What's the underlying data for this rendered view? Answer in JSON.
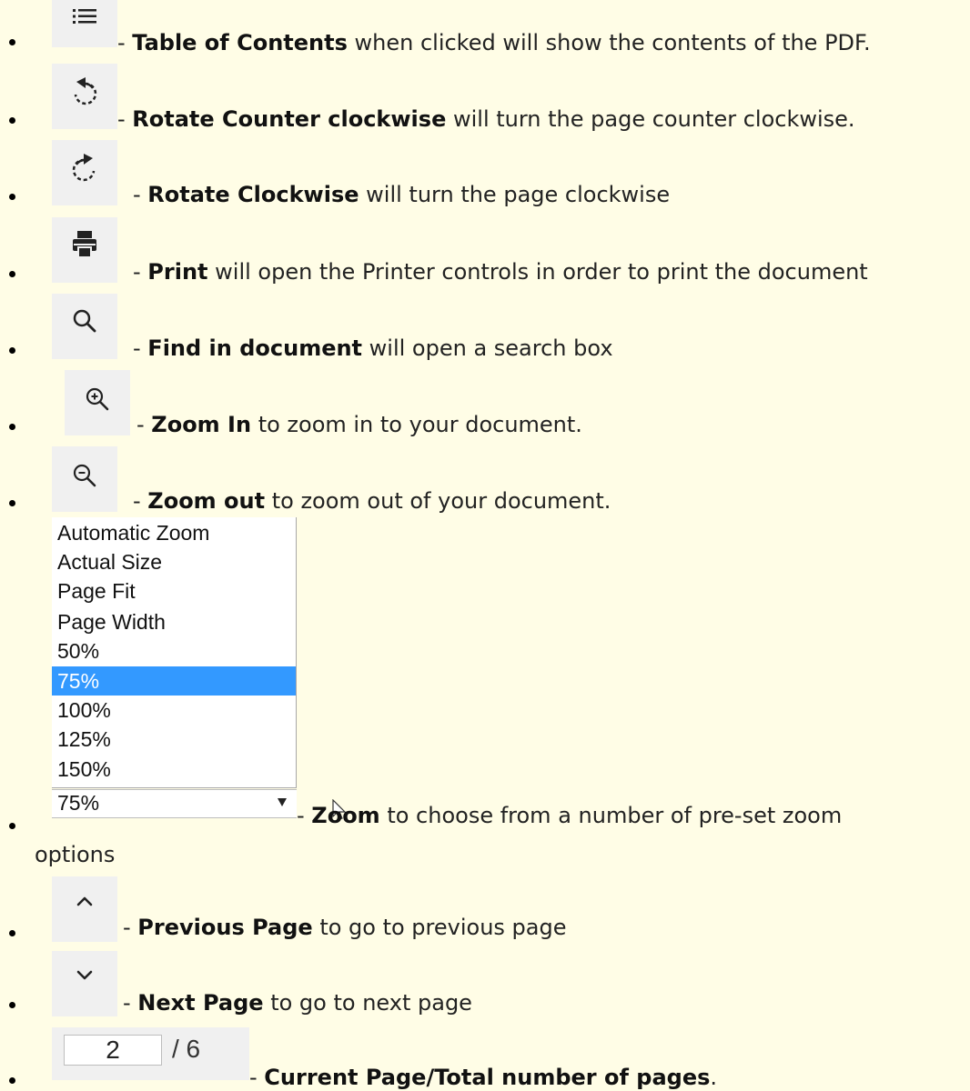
{
  "items": [
    {
      "icon": "list-icon",
      "title": "Table of Contents",
      "rest": " when clicked will show the contents of the PDF."
    },
    {
      "icon": "rotate-counterclockwise-icon",
      "title": "Rotate Counter clockwise",
      "rest": " will turn the page counter clockwise."
    },
    {
      "icon": "rotate-clockwise-icon",
      "title": "Rotate Clockwise",
      "rest": " will turn the page clockwise"
    },
    {
      "icon": "printer-icon",
      "title": "Print",
      "rest": " will open the Printer controls in order to print the document"
    },
    {
      "icon": "search-icon",
      "title": "Find in document",
      "rest": " will open a search box"
    },
    {
      "icon": "zoom-in-icon",
      "title": "Zoom In",
      "rest": " to zoom in to your document."
    },
    {
      "icon": "zoom-out-icon",
      "title": "Zoom out",
      "rest": " to zoom out of your document."
    },
    {
      "icon": "zoom-select",
      "title": "Zoom",
      "rest": " to choose from a number of pre-set zoom",
      "rest2": "options"
    },
    {
      "icon": "chevron-up-icon",
      "title": "Previous Page",
      "rest": " to go to previous page"
    },
    {
      "icon": "chevron-down-icon",
      "title": "Next Page",
      "rest": " to go to next page"
    },
    {
      "icon": "page-number-box",
      "title": "Current Page/Total number of pages",
      "rest": "."
    }
  ],
  "separator": " - ",
  "zoom": {
    "options": [
      "Automatic Zoom",
      "Actual Size",
      "Page Fit",
      "Page Width",
      "50%",
      "75%",
      "100%",
      "125%",
      "150%"
    ],
    "selected": "75%"
  },
  "page_nav": {
    "current": "2",
    "total": "/ 6"
  },
  "colors": {
    "background": "#fffde6",
    "button_bg": "#f0f0f0",
    "selection": "#3399ff"
  }
}
